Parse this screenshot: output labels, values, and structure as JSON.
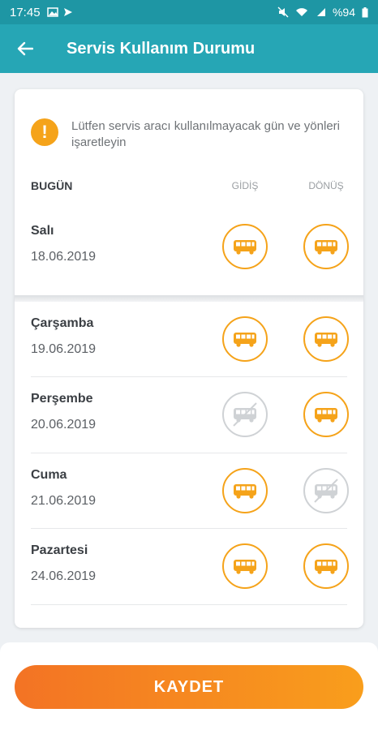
{
  "status_bar": {
    "time": "17:45",
    "battery": "%94"
  },
  "app_bar": {
    "title": "Servis Kullanım Durumu"
  },
  "notice": {
    "text": "Lütfen servis aracı kullanılmayacak gün ve yönleri işaretleyin"
  },
  "table_header": {
    "today": "BUGÜN",
    "col_go": "GİDİŞ",
    "col_return": "DÖNÜŞ"
  },
  "today_row": {
    "day": "Salı",
    "date": "18.06.2019",
    "go_active": true,
    "return_active": true
  },
  "rows": [
    {
      "day": "Çarşamba",
      "date": "19.06.2019",
      "go_active": true,
      "return_active": true
    },
    {
      "day": "Perşembe",
      "date": "20.06.2019",
      "go_active": false,
      "return_active": true
    },
    {
      "day": "Cuma",
      "date": "21.06.2019",
      "go_active": true,
      "return_active": false
    },
    {
      "day": "Pazartesi",
      "date": "24.06.2019",
      "go_active": true,
      "return_active": true
    }
  ],
  "save_button": {
    "label": "KAYDET"
  },
  "colors": {
    "teal": "#26a6b5",
    "orange": "#f5a31a",
    "inactive": "#cfd2d5"
  }
}
